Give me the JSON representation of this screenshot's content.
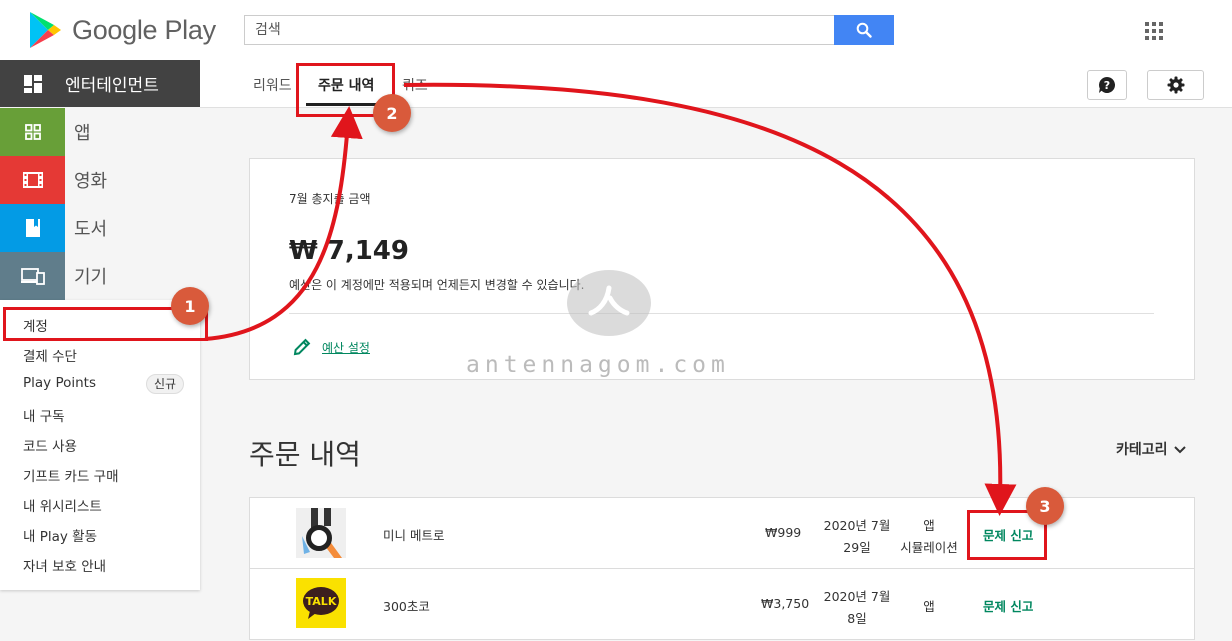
{
  "header": {
    "logo_text": "Google Play",
    "search_placeholder": "검색"
  },
  "sidebar": {
    "entertainment_label": "엔터테인먼트",
    "categories": [
      {
        "label": "앱",
        "color": "#689f38"
      },
      {
        "label": "영화",
        "color": "#e53935"
      },
      {
        "label": "도서",
        "color": "#039be5"
      },
      {
        "label": "기기",
        "color": "#607d8b"
      }
    ],
    "account_items": [
      "계정",
      "결제 수단",
      "Play Points",
      "내 구독",
      "코드 사용",
      "기프트 카드 구매",
      "내 위시리스트",
      "내 Play 활동",
      "자녀 보호 안내"
    ],
    "new_badge": "신규"
  },
  "tabs": {
    "rewards": "리워드",
    "orders": "주문 내역",
    "quiz": "퀴즈"
  },
  "budget": {
    "title": "7월 총지출 금액",
    "amount": "₩ 7,149",
    "note": "예산은 이 계정에만 적용되며 언제든지 변경할 수 있습니다.",
    "link": "예산 설정"
  },
  "watermark": {
    "text": "antennagom.com"
  },
  "orders": {
    "title": "주문 내역",
    "category_label": "카테고리",
    "rows": [
      {
        "name": "미니 메트로",
        "price": "₩999",
        "date_line1": "2020년 7월",
        "date_line2": "29일",
        "type_line1": "앱",
        "type_line2": "시뮬레이션",
        "report": "문제 신고",
        "thumb": "mini-metro-icon"
      },
      {
        "name": "300초코",
        "price": "₩3,750",
        "date_line1": "2020년 7월",
        "date_line2": "8일",
        "type_line1": "앱",
        "type_line2": "",
        "report": "문제 신고",
        "thumb": "kakaotalk-icon"
      }
    ]
  },
  "annotations": {
    "step1": "1",
    "step2": "2",
    "step3": "3",
    "color": "#e0151c"
  }
}
